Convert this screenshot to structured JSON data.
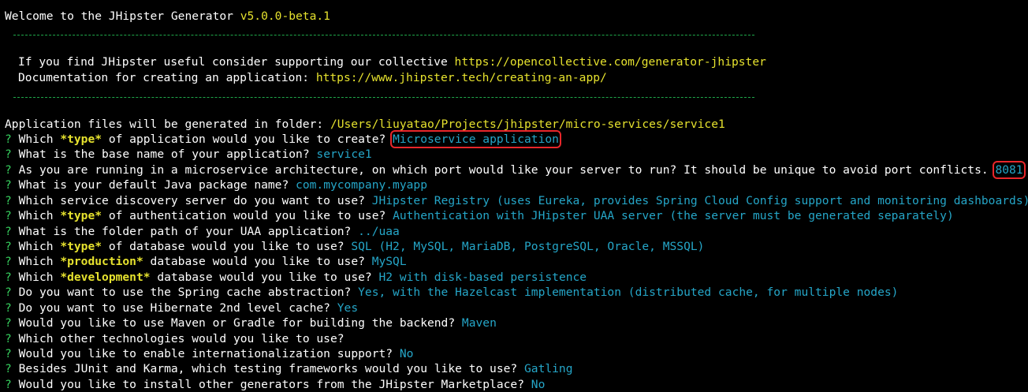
{
  "header": {
    "welcome_text": "Welcome to the JHipster Generator ",
    "version": "v5.0.0-beta.1"
  },
  "banner": {
    "support_text": "If you find JHipster useful consider supporting our collective ",
    "support_url": "https://opencollective.com/generator-jhipster",
    "docs_text": "Documentation for creating an application: ",
    "docs_url": "https://www.jhipster.tech/creating-an-app/"
  },
  "folder": {
    "text": "Application files will be generated in folder: ",
    "path": "/Users/liuyatao/Projects/jhipster/micro-services/service1"
  },
  "prompt_marker": "?",
  "questions": [
    {
      "pre": "Which ",
      "emph": "*type*",
      "post": " of application would you like to create? ",
      "answer": "Microservice application"
    },
    {
      "pre": "What is the base name of your application? ",
      "emph": "",
      "post": "",
      "answer": "service1"
    },
    {
      "pre": "As you are running in a microservice architecture, on which port would like your server to run? It should be unique to avoid port conflicts. ",
      "emph": "",
      "post": "",
      "answer": "8081"
    },
    {
      "pre": "What is your default Java package name? ",
      "emph": "",
      "post": "",
      "answer": "com.mycompany.myapp"
    },
    {
      "pre": "Which service discovery server do you want to use? ",
      "emph": "",
      "post": "",
      "answer": "JHipster Registry (uses Eureka, provides Spring Cloud Config support and monitoring dashboards)"
    },
    {
      "pre": "Which ",
      "emph": "*type*",
      "post": " of authentication would you like to use? ",
      "answer": "Authentication with JHipster UAA server (the server must be generated separately)"
    },
    {
      "pre": "What is the folder path of your UAA application? ",
      "emph": "",
      "post": "",
      "answer": "../uaa"
    },
    {
      "pre": "Which ",
      "emph": "*type*",
      "post": " of database would you like to use? ",
      "answer": "SQL (H2, MySQL, MariaDB, PostgreSQL, Oracle, MSSQL)"
    },
    {
      "pre": "Which ",
      "emph": "*production*",
      "post": " database would you like to use? ",
      "answer": "MySQL"
    },
    {
      "pre": "Which ",
      "emph": "*development*",
      "post": " database would you like to use? ",
      "answer": "H2 with disk-based persistence"
    },
    {
      "pre": "Do you want to use the Spring cache abstraction? ",
      "emph": "",
      "post": "",
      "answer": "Yes, with the Hazelcast implementation (distributed cache, for multiple nodes)"
    },
    {
      "pre": "Do you want to use Hibernate 2nd level cache? ",
      "emph": "",
      "post": "",
      "answer": "Yes"
    },
    {
      "pre": "Would you like to use Maven or Gradle for building the backend? ",
      "emph": "",
      "post": "",
      "answer": "Maven"
    },
    {
      "pre": "Which other technologies would you like to use? ",
      "emph": "",
      "post": "",
      "answer": ""
    },
    {
      "pre": "Would you like to enable internationalization support? ",
      "emph": "",
      "post": "",
      "answer": "No"
    },
    {
      "pre": "Besides JUnit and Karma, which testing frameworks would you like to use? ",
      "emph": "",
      "post": "",
      "answer": "Gatling"
    },
    {
      "pre": "Would you like to install other generators from the JHipster Marketplace? ",
      "emph": "",
      "post": "",
      "answer": "No"
    }
  ],
  "colors": {
    "background": "#000000",
    "prompt_marker": "#37d05e",
    "highlight_yellow": "#e6e22e",
    "answer_cyan": "#25a6c8",
    "separator_green": "#1fa84a",
    "annotation_red": "#e8262a"
  }
}
